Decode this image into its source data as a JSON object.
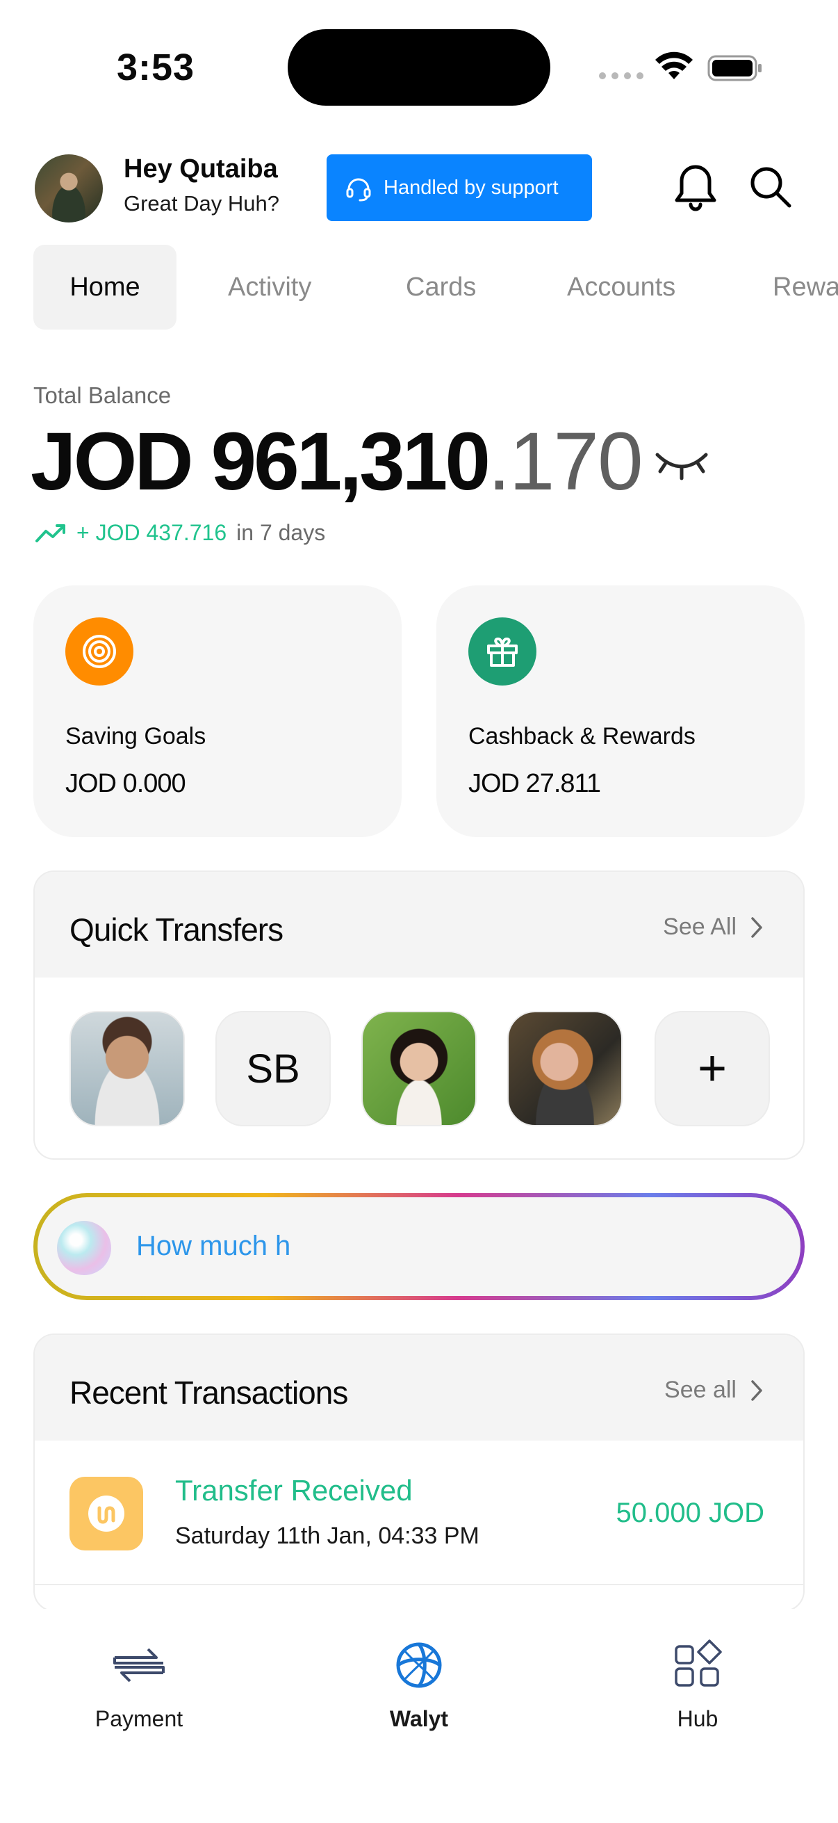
{
  "status_bar": {
    "time": "3:53"
  },
  "header": {
    "greeting_name": "Hey Qutaiba",
    "greeting_sub": "Great Day Huh?",
    "support_label": "Handled by support"
  },
  "tabs": [
    {
      "label": "Home",
      "active": true
    },
    {
      "label": "Activity"
    },
    {
      "label": "Cards"
    },
    {
      "label": "Accounts"
    },
    {
      "label": "Rewa"
    }
  ],
  "balance": {
    "label": "Total Balance",
    "currency": "JOD",
    "integer": "961,310",
    "decimal": ".170",
    "change_amount": "+ JOD 437.716",
    "change_period": "in 7 days"
  },
  "cards": [
    {
      "title": "Saving Goals",
      "value": "JOD 0.000",
      "icon": "target-icon",
      "color": "#ff8c00"
    },
    {
      "title": "Cashback & Rewards",
      "value": "JOD 27.811",
      "icon": "gift-icon",
      "color": "#1e9e73"
    }
  ],
  "quick_transfers": {
    "title": "Quick Transfers",
    "see_all": "See All",
    "initials_contact": "SB",
    "add_label": "+"
  },
  "assistant": {
    "text": "How much h"
  },
  "recent_transactions": {
    "title": "Recent Transactions",
    "see_all": "See all",
    "items": [
      {
        "title": "Transfer Received",
        "date": "Saturday 11th Jan, 04:33 PM",
        "amount": "50.000 JOD"
      }
    ]
  },
  "bottom_nav": [
    {
      "label": "Payment"
    },
    {
      "label": "Walyt",
      "active": true
    },
    {
      "label": "Hub"
    }
  ],
  "colors": {
    "accent": "#0a84ff",
    "positive": "#21bd8a"
  }
}
